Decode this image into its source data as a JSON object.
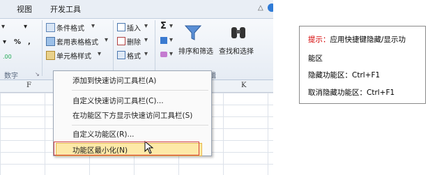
{
  "tabs": [
    {
      "label": "视图"
    },
    {
      "label": "开发工具"
    }
  ],
  "ribbon": {
    "number_format_symbols": {
      "percent": "%",
      "comma": ","
    },
    "decimal_icon_label": ".00",
    "number_group_label": "数字",
    "styles": {
      "conditional_format": "条件格式",
      "table_style": "套用表格格式",
      "cell_style": "单元格样式"
    },
    "cells": {
      "insert": "插入",
      "delete": "删除",
      "format": "格式"
    },
    "editing": {
      "sum_symbol": "Σ",
      "sort_filter": "排序和筛选",
      "find_select": "查找和选择",
      "group_label": "编辑"
    }
  },
  "columns": [
    {
      "label": "F"
    },
    {
      "label": "K"
    }
  ],
  "context_menu": {
    "items": [
      {
        "label": "添加到快速访问工具栏(A)"
      },
      {
        "label": "自定义快速访问工具栏(C)..."
      },
      {
        "label": "在功能区下方显示快速访问工具栏(S)"
      },
      {
        "label": "自定义功能区(R)..."
      },
      {
        "label": "功能区最小化(N)"
      }
    ]
  },
  "tip": {
    "title_prefix": "提示：",
    "title_text": "应用快捷键隐藏/显示功",
    "title_cont": "能区",
    "hide_line": "隐藏功能区：Ctrl+F1",
    "cancel_line": "取消隐藏功能区：Ctrl+F1",
    "prefix_color": "#d40000"
  },
  "colors": {
    "highlight": "#fde9a8",
    "highlight_border": "#e8b84c",
    "annotation_red": "#d23f3f"
  }
}
